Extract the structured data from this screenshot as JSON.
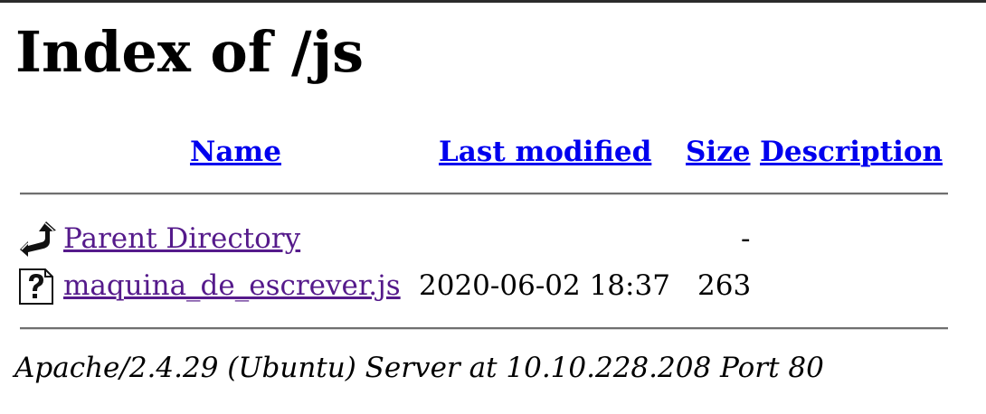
{
  "page": {
    "title": "Index of /js"
  },
  "table": {
    "headers": {
      "name": "Name",
      "last_modified": "Last modified",
      "size": "Size",
      "description": "Description"
    },
    "rows": [
      {
        "icon": "back-icon",
        "name": "Parent Directory",
        "last_modified": "",
        "size": "-",
        "description": ""
      },
      {
        "icon": "unknown-file-icon",
        "name": "maquina_de_escrever.js",
        "last_modified": "2020-06-02 18:37",
        "size": "263",
        "description": ""
      }
    ]
  },
  "footer": {
    "server_signature": "Apache/2.4.29 (Ubuntu) Server at 10.10.228.208 Port 80"
  },
  "colors": {
    "link": "#0000ee",
    "visited_link": "#551a8b",
    "rule": "#6f6f6f"
  }
}
